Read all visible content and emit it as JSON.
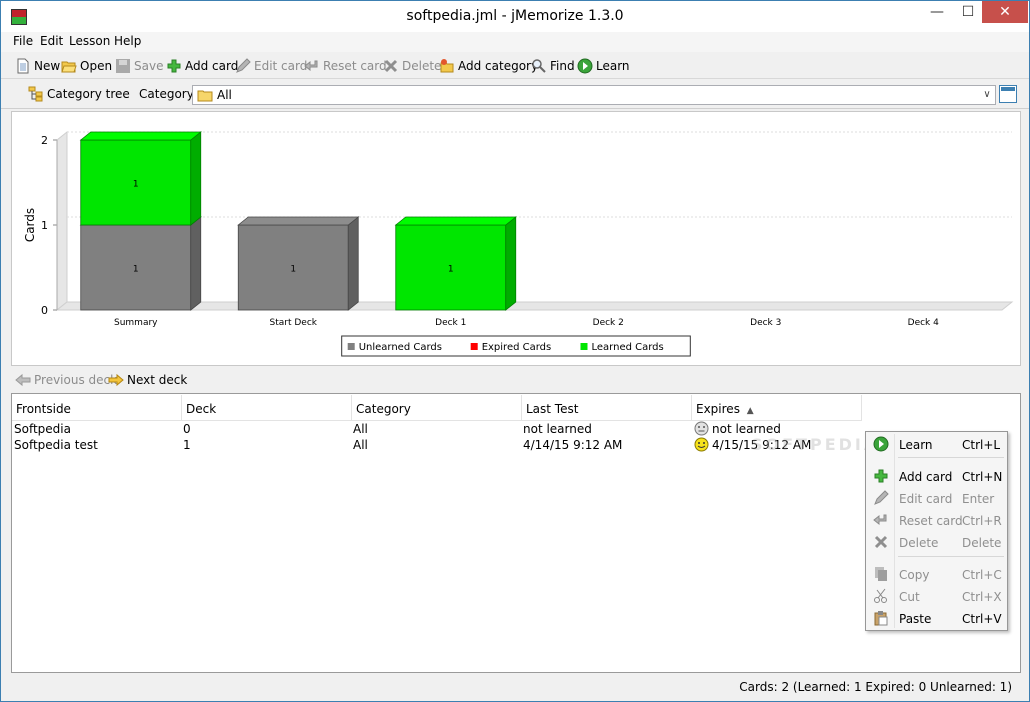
{
  "window": {
    "title": "softpedia.jml - jMemorize 1.3.0",
    "minimize": "—",
    "maximize": "☐",
    "close": "✕"
  },
  "menu": [
    "File",
    "Edit",
    "Lesson",
    "Help"
  ],
  "toolbar": {
    "new": "New",
    "open": "Open",
    "save": "Save",
    "add_card": "Add card",
    "edit_card": "Edit card",
    "reset_card": "Reset card",
    "delete": "Delete",
    "add_category": "Add category",
    "find": "Find",
    "learn": "Learn"
  },
  "filter": {
    "category_tree": "Category tree",
    "category_label": "Category",
    "category_value": "All"
  },
  "chart_data": {
    "type": "bar",
    "stacked": true,
    "categories": [
      "Summary",
      "Start Deck",
      "Deck 1",
      "Deck 2",
      "Deck 3",
      "Deck 4"
    ],
    "series": [
      {
        "name": "Unlearned Cards",
        "color": "#808080",
        "values": [
          1,
          1,
          0,
          0,
          0,
          0
        ]
      },
      {
        "name": "Expired Cards",
        "color": "#ff0000",
        "values": [
          0,
          0,
          0,
          0,
          0,
          0
        ]
      },
      {
        "name": "Learned Cards",
        "color": "#00e600",
        "values": [
          1,
          0,
          1,
          0,
          0,
          0
        ]
      }
    ],
    "ylabel": "Cards",
    "yticks": [
      0,
      1,
      2
    ],
    "ylim": [
      0,
      2
    ],
    "legend": "bottom-center",
    "grid": true
  },
  "decknav": {
    "previous": "Previous deck",
    "next": "Next deck"
  },
  "table": {
    "headers": [
      "Frontside",
      "Deck",
      "Category",
      "Last Test",
      "Expires"
    ],
    "sort_indicator": "▲",
    "rows": [
      {
        "frontside": "Softpedia",
        "deck": "0",
        "category": "All",
        "last_test": "not learned",
        "expires": "not learned",
        "icon": "neutral-face-icon"
      },
      {
        "frontside": "Softpedia test",
        "deck": "1",
        "category": "All",
        "last_test": "4/14/15 9:12 AM",
        "expires": "4/15/15 9:12 AM",
        "icon": "smiley-icon"
      }
    ]
  },
  "watermark": "SOFTPEDIA",
  "context_menu": [
    {
      "label": "Learn",
      "shortcut": "Ctrl+L",
      "enabled": true,
      "icon": "learn-icon"
    },
    {
      "label": "Add card",
      "shortcut": "Ctrl+N",
      "enabled": true,
      "icon": "plus-icon"
    },
    {
      "label": "Edit card",
      "shortcut": "Enter",
      "enabled": false,
      "icon": "pencil-icon"
    },
    {
      "label": "Reset card",
      "shortcut": "Ctrl+R",
      "enabled": false,
      "icon": "reset-arrow-icon"
    },
    {
      "label": "Delete",
      "shortcut": "Delete",
      "enabled": false,
      "icon": "delete-x-icon"
    },
    {
      "label": "Copy",
      "shortcut": "Ctrl+C",
      "enabled": false,
      "icon": "copy-icon"
    },
    {
      "label": "Cut",
      "shortcut": "Ctrl+X",
      "enabled": false,
      "icon": "scissors-icon"
    },
    {
      "label": "Paste",
      "shortcut": "Ctrl+V",
      "enabled": true,
      "icon": "clipboard-icon"
    }
  ],
  "status": "Cards: 2 (Learned: 1  Expired: 0  Unlearned: 1)"
}
